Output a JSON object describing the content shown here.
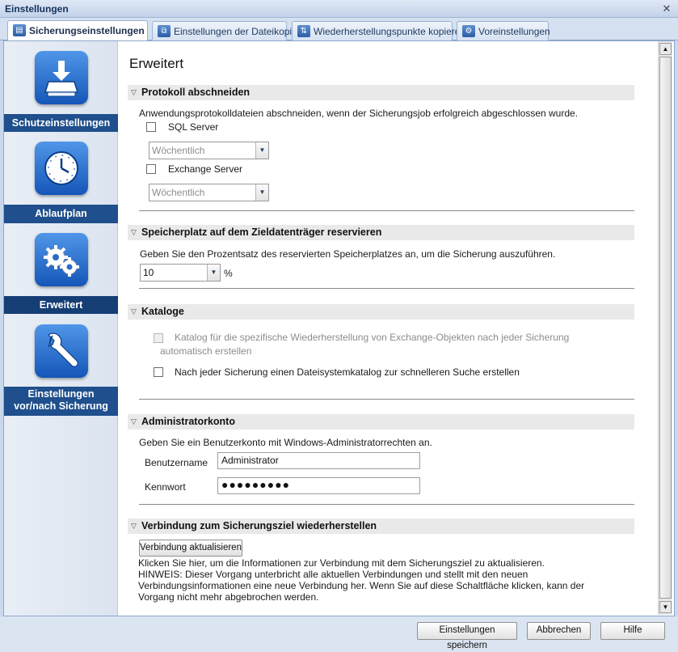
{
  "window": {
    "title": "Einstellungen"
  },
  "tabs": [
    {
      "label": "Sicherungseinstellungen",
      "active": true
    },
    {
      "label": "Einstellungen der Dateikopie",
      "active": false
    },
    {
      "label": "Wiederherstellungspunkte kopieren",
      "active": false
    },
    {
      "label": "Voreinstellungen",
      "active": false
    }
  ],
  "sidebar": {
    "items": [
      {
        "label": "Schutzeinstellungen",
        "icon": "drive-download-icon"
      },
      {
        "label": "Ablaufplan",
        "icon": "clock-icon"
      },
      {
        "label": "Erweitert",
        "icon": "gears-icon",
        "selected": true
      },
      {
        "label_line1": "Einstellungen",
        "label_line2": "vor/nach Sicherung",
        "icon": "wrench-icon"
      }
    ]
  },
  "main": {
    "title": "Erweitert",
    "log_truncation": {
      "heading": "Protokoll abschneiden",
      "description": "Anwendungsprotokolldateien abschneiden, wenn der Sicherungsjob erfolgreich abgeschlossen wurde.",
      "sql_label": "SQL Server",
      "sql_checked": false,
      "sql_frequency": "Wöchentlich",
      "exchange_label": "Exchange Server",
      "exchange_checked": false,
      "exchange_frequency": "Wöchentlich"
    },
    "reserve_space": {
      "heading": "Speicherplatz auf dem Zieldatenträger reservieren",
      "description": "Geben Sie den Prozentsatz des reservierten Speicherplatzes an, um die Sicherung auszuführen.",
      "value": "10",
      "unit": "%"
    },
    "catalogs": {
      "heading": "Kataloge",
      "exchange_catalog_line1": "Katalog für die spezifische Wiederherstellung von Exchange-Objekten nach jeder Sicherung",
      "exchange_catalog_line2": "automatisch erstellen",
      "filesystem_catalog": "Nach jeder Sicherung einen Dateisystemkatalog zur schnelleren Suche erstellen"
    },
    "admin": {
      "heading": "Administratorkonto",
      "description": "Geben Sie ein Benutzerkonto mit Windows-Administratorrechten an.",
      "username_label": "Benutzername",
      "username_value": "Administrator",
      "password_label": "Kennwort",
      "password_value": "●●●●●●●●●"
    },
    "connection": {
      "heading": "Verbindung zum Sicherungsziel wiederherstellen",
      "button": "Verbindung aktualisieren",
      "note": "Klicken Sie hier, um die Informationen zur Verbindung mit dem Sicherungsziel zu aktualisieren.\nHINWEIS: Dieser Vorgang unterbricht alle aktuellen Verbindungen und stellt mit den neuen\nVerbindungsinformationen eine neue Verbindung her. Wenn Sie auf diese Schaltfläche klicken, kann der\nVorgang nicht mehr abgebrochen werden."
    }
  },
  "footer": {
    "save": "Einstellungen speichern",
    "cancel": "Abbrechen",
    "help": "Hilfe"
  }
}
